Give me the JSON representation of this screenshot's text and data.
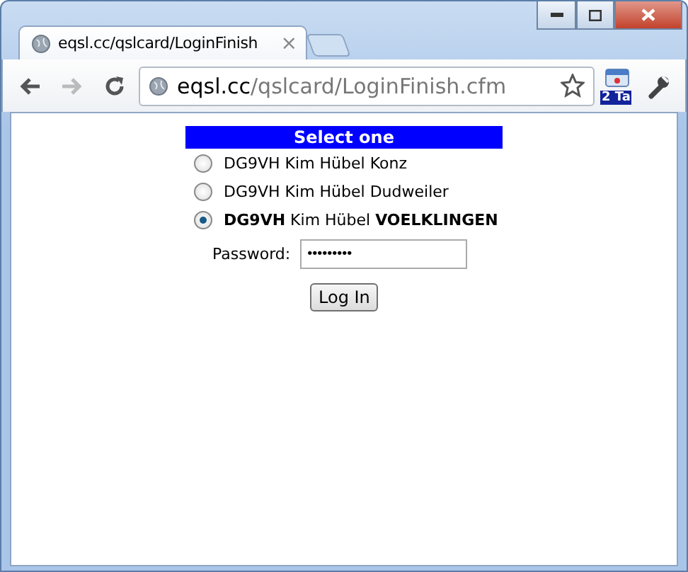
{
  "tab": {
    "title": "eqsl.cc/qslcard/LoginFinish",
    "close": "×"
  },
  "address_bar": {
    "domain": "eqsl.cc",
    "path": "/qslcard/LoginFinish.cfm"
  },
  "extension_badge": "2 Ta",
  "form": {
    "heading": "Select one",
    "options": [
      {
        "callsign": "DG9VH",
        "name": "Kim Hübel",
        "location": "Konz",
        "selected": false
      },
      {
        "callsign": "DG9VH",
        "name": "Kim Hübel",
        "location": "Dudweiler",
        "selected": false
      },
      {
        "callsign": "DG9VH",
        "name": "Kim Hübel",
        "location": "VOELKLINGEN",
        "selected": true
      }
    ],
    "password_label": "Password:",
    "password_value": "•••••••••",
    "submit": "Log In"
  }
}
